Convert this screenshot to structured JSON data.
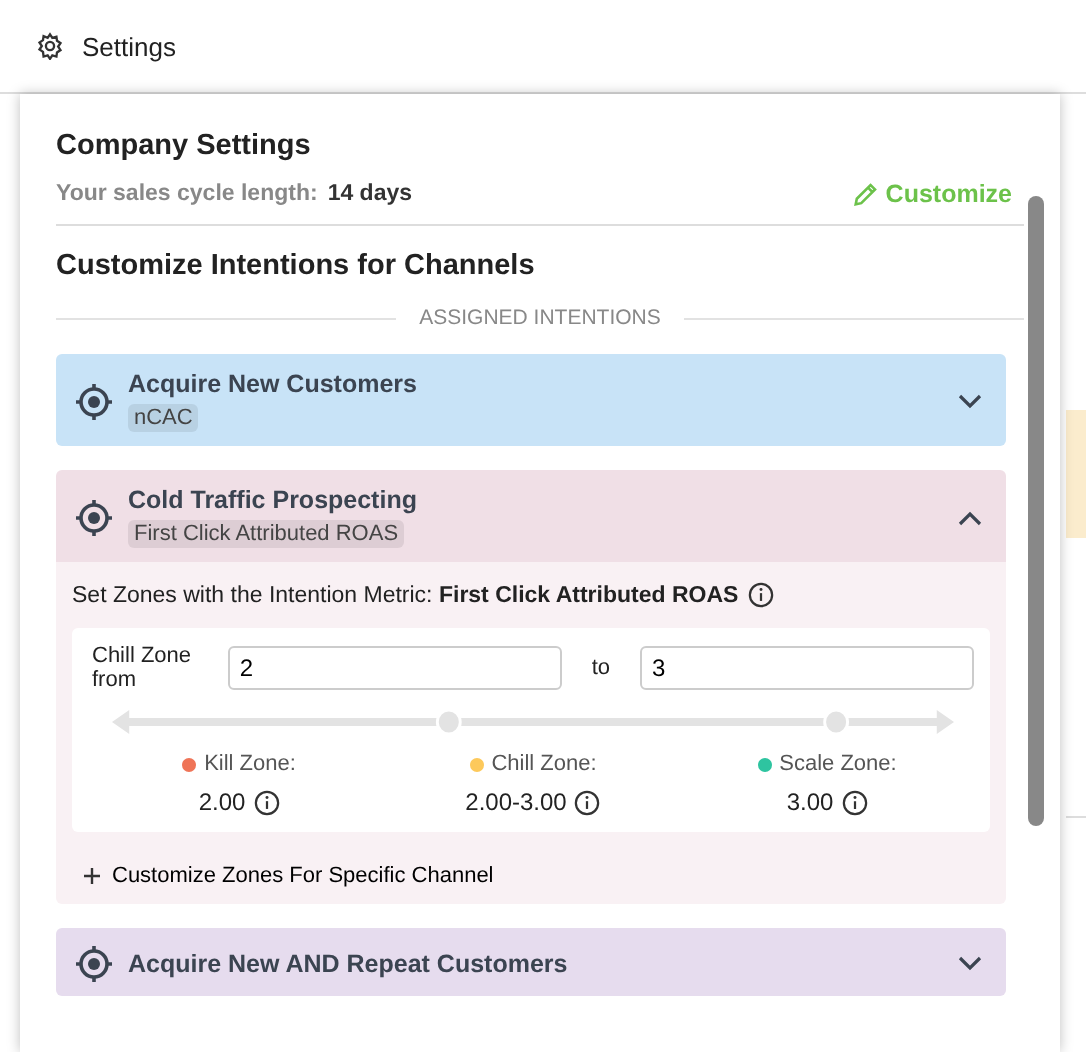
{
  "header": {
    "title": "Settings"
  },
  "company": {
    "title": "Company Settings",
    "cycle_label": "Your sales cycle length:",
    "cycle_value": "14 days",
    "customize": "Customize"
  },
  "intentions_section": {
    "title": "Customize Intentions for Channels",
    "divider_label": "ASSIGNED INTENTIONS"
  },
  "intentions": [
    {
      "title": "Acquire New Customers",
      "metric": "nCAC",
      "expanded": false,
      "color": "#c8e3f7"
    },
    {
      "title": "Cold Traffic Prospecting",
      "metric": "First Click Attributed ROAS",
      "expanded": true,
      "color": "#f0dfe6",
      "details": {
        "metric_label": "Set Zones with the Intention Metric:",
        "metric_name": "First Click Attributed ROAS",
        "from_label": "Chill Zone from",
        "from_value": "2",
        "to_label": "to",
        "to_value": "3",
        "thumbs": [
          {
            "level": 0.4
          },
          {
            "level": 0.86
          }
        ],
        "zones": [
          {
            "label": "Kill Zone:",
            "value": "2.00",
            "color": "#ef7457"
          },
          {
            "label": "Chill Zone:",
            "value": "2.00-3.00",
            "color": "#fdc95b"
          },
          {
            "label": "Scale Zone:",
            "value": "3.00",
            "color": "#2ec4a0"
          }
        ],
        "customize_link": "Customize Zones For Specific Channel"
      }
    },
    {
      "title": "Acquire New AND Repeat Customers",
      "expanded": false,
      "color": "#e6dcee"
    }
  ]
}
